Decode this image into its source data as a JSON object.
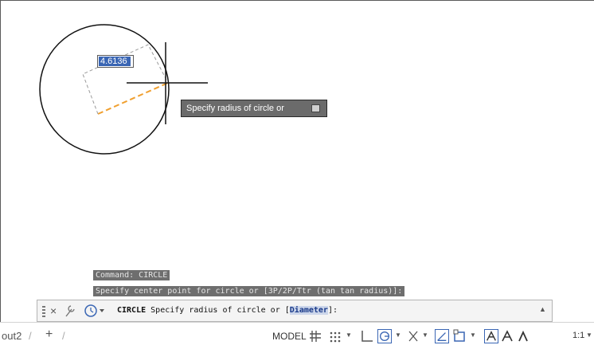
{
  "drawing": {
    "dynamic_input_value": "4.6136",
    "tooltip_text": "Specify radius of circle or"
  },
  "command_history": [
    "Command: CIRCLE",
    "Specify center point for circle or [3P/2P/Ttr (tan tan radius)]:"
  ],
  "command_line": {
    "command": "CIRCLE",
    "prompt": "Specify radius of circle or",
    "bracket_open": "[",
    "option": "Diameter",
    "bracket_close": "]:"
  },
  "status_bar": {
    "layout_tab": "out2",
    "add_tab": "+",
    "model_label": "MODEL",
    "scale": "1:1"
  },
  "colors": {
    "accent": "#3a66b4",
    "rubberband": "#f0a030",
    "tooltip_bg": "#6b6b6b",
    "history_bg": "#6e6e6e",
    "active_toggle": "#3a66b4"
  },
  "icons": [
    "close-icon",
    "wrench-icon",
    "recent-commands-icon",
    "grid-icon",
    "snap-icon",
    "ortho-icon",
    "polar-icon",
    "isodraft-icon",
    "osnap-icon",
    "selection-cycling-icon",
    "annotation-visibility-icon",
    "autoscale-icon",
    "annotation-scale-icon"
  ]
}
